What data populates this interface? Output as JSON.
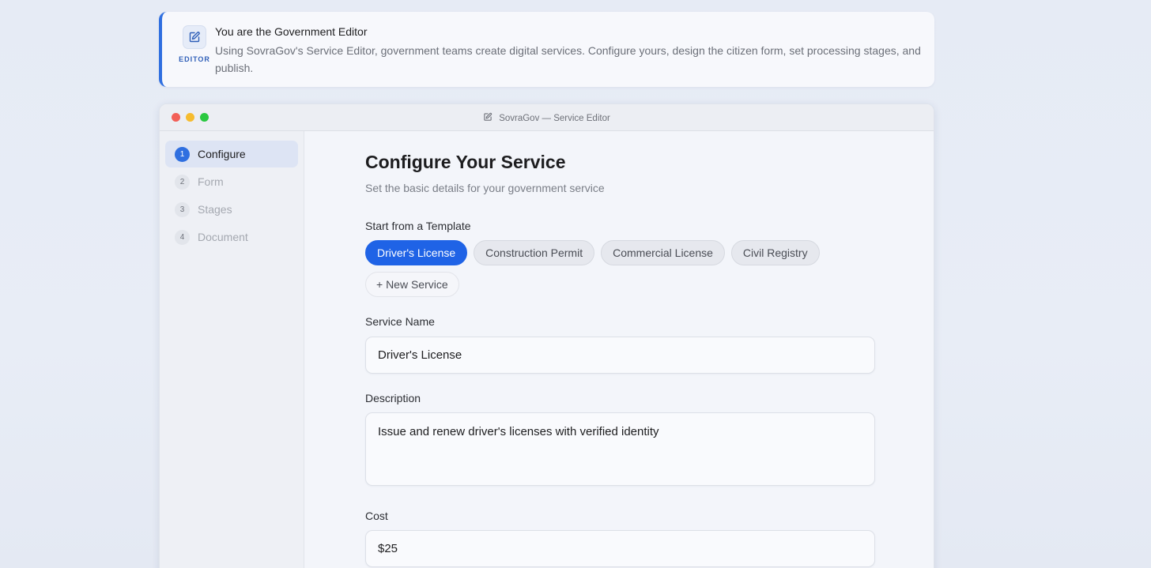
{
  "banner": {
    "badge_label": "EDITOR",
    "title": "You are the Government Editor",
    "text": "Using SovraGov's Service Editor, government teams create digital services. Configure yours, design the citizen form, set processing stages, and publish."
  },
  "window": {
    "title": "SovraGov — Service Editor"
  },
  "sidebar": {
    "steps": [
      {
        "number": "1",
        "label": "Configure",
        "active": true
      },
      {
        "number": "2",
        "label": "Form",
        "active": false
      },
      {
        "number": "3",
        "label": "Stages",
        "active": false
      },
      {
        "number": "4",
        "label": "Document",
        "active": false
      }
    ]
  },
  "main": {
    "title": "Configure Your Service",
    "subtitle": "Set the basic details for your government service",
    "template_label": "Start from a Template",
    "templates": [
      {
        "label": "Driver's License",
        "selected": true
      },
      {
        "label": "Construction Permit",
        "selected": false
      },
      {
        "label": "Commercial License",
        "selected": false
      },
      {
        "label": "Civil Registry",
        "selected": false
      }
    ],
    "new_service_label": "+ New Service",
    "service_name": {
      "label": "Service Name",
      "value": "Driver's License"
    },
    "description": {
      "label": "Description",
      "value": "Issue and renew driver's licenses with verified identity"
    },
    "cost": {
      "label": "Cost",
      "value": "$25"
    }
  },
  "colors": {
    "accent": "#1f63e6",
    "banner_border": "#2f6fe0"
  },
  "icons": {
    "banner": "edit-icon",
    "window_title": "edit-icon"
  }
}
